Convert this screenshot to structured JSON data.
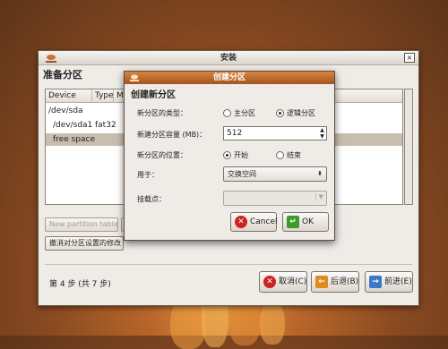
{
  "main_window": {
    "title": "安装",
    "close_glyph": "×",
    "heading": "准备分区",
    "columns": [
      "Device",
      "Type",
      "Mo"
    ],
    "rows": [
      {
        "device": "/dev/sda",
        "type": ""
      },
      {
        "device": "/dev/sda1",
        "type": "fat32"
      },
      {
        "device": "free space",
        "type": ""
      }
    ],
    "new_table_button": "New partition table",
    "undo_button": "撤消对分区设置的修改",
    "step_text": "第 4 步 (共 7 步)",
    "nav": {
      "cancel": "取消(C)",
      "back": "后退(B)",
      "forward": "前进(E)"
    }
  },
  "dialog": {
    "title": "创建分区",
    "heading": "创建新分区",
    "type_label": "新分区的类型：",
    "type_options": [
      "主分区",
      "逻辑分区"
    ],
    "type_selected": "逻辑分区",
    "size_label": "新建分区容量 (MB)：",
    "size_value": "512",
    "location_label": "新分区的位置：",
    "location_options": [
      "开始",
      "结束"
    ],
    "location_selected": "开始",
    "use_label": "用于：",
    "use_value": "交换空间",
    "mount_label": "挂载点：",
    "mount_value": "",
    "cancel_button": "Cancel",
    "ok_button": "OK"
  },
  "colors": {
    "accent": "#c0692b",
    "dialog_title": "#b8602a",
    "selection": "#c9bdb0"
  }
}
